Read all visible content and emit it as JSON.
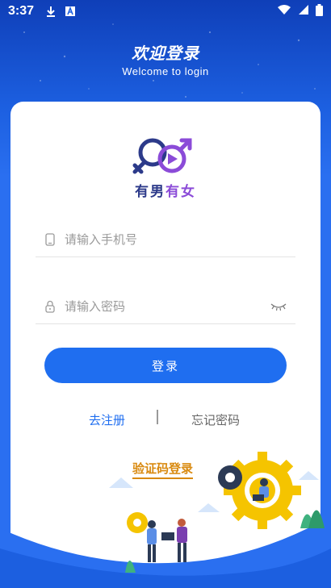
{
  "status_bar": {
    "time": "3:37",
    "icons": [
      "download-icon",
      "a-badge-icon",
      "wifi-icon",
      "signal-icon",
      "battery-icon"
    ]
  },
  "header": {
    "title": "欢迎登录",
    "subtitle": "Welcome to login"
  },
  "brand": {
    "name_part1": "有男",
    "name_part2": "有女",
    "logo_icon": "gender-symbols-play-icon"
  },
  "form": {
    "phone_placeholder": "请输入手机号",
    "phone_value": "",
    "password_placeholder": "请输入密码",
    "password_value": "",
    "login_label": "登录"
  },
  "links": {
    "register": "去注册",
    "separator": "|",
    "forgot": "忘记密码",
    "code_login": "验证码登录"
  },
  "colors": {
    "primary": "#1f6ef0",
    "header_bg": "#1c5fe0",
    "accent_orange": "#d98a10",
    "brand_dark": "#2c3a8a",
    "brand_purple": "#8b4bd8"
  }
}
